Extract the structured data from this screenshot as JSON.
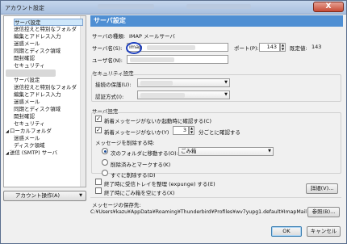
{
  "window": {
    "title": "アカウント設定",
    "close_label": "X"
  },
  "sidebar": {
    "items": [
      {
        "label": "サーバ設定",
        "indent": 1,
        "selected": true,
        "blurred": false
      },
      {
        "label": "送信控えと特別なフォルダ",
        "indent": 1,
        "selected": false,
        "blurred": false
      },
      {
        "label": "編集とアドレス入力",
        "indent": 1,
        "selected": false,
        "blurred": false
      },
      {
        "label": "迷惑メール",
        "indent": 1,
        "selected": false,
        "blurred": false
      },
      {
        "label": "同期とディスク領域",
        "indent": 1,
        "selected": false,
        "blurred": false
      },
      {
        "label": "開封確認",
        "indent": 1,
        "selected": false,
        "blurred": false
      },
      {
        "label": "セキュリティ",
        "indent": 1,
        "selected": false,
        "blurred": false
      },
      {
        "label": "xxxxxxxxxxxxxxxx",
        "indent": 0,
        "selected": false,
        "blurred": true
      },
      {
        "label": "サーバ設定",
        "indent": 1,
        "selected": false,
        "blurred": false
      },
      {
        "label": "送信控えと特別なフォルダ",
        "indent": 1,
        "selected": false,
        "blurred": false
      },
      {
        "label": "編集とアドレス入力",
        "indent": 1,
        "selected": false,
        "blurred": false
      },
      {
        "label": "迷惑メール",
        "indent": 1,
        "selected": false,
        "blurred": false
      },
      {
        "label": "同期とディスク領域",
        "indent": 1,
        "selected": false,
        "blurred": false
      },
      {
        "label": "開封確認",
        "indent": 1,
        "selected": false,
        "blurred": false
      },
      {
        "label": "セキュリティ",
        "indent": 1,
        "selected": false,
        "blurred": false
      },
      {
        "label": "ローカルフォルダ",
        "indent": 0,
        "selected": false,
        "blurred": false
      },
      {
        "label": "迷惑メール",
        "indent": 1,
        "selected": false,
        "blurred": false
      },
      {
        "label": "ディスク領域",
        "indent": 1,
        "selected": false,
        "blurred": false
      },
      {
        "label": "送信 (SMTP) サーバ",
        "indent": 0,
        "selected": false,
        "blurred": false
      }
    ],
    "account_actions_label": "アカウント操作(A)"
  },
  "main": {
    "header": "サーバ設定",
    "server_type_label": "サーバの種類:",
    "server_type_value": "IMAP メールサーバ",
    "server_name_label": "サーバ名(S):",
    "server_name_value": "imap",
    "port_label": "ポート(P):",
    "port_value": "143",
    "default_label": "既定値:",
    "default_value": "143",
    "username_label": "ユーザ名(N):",
    "security_section": "セキュリティ設定",
    "connection_security_label": "接続の保護(U):",
    "auth_method_label": "認証方式(I):",
    "server_settings_section": "サーバ設定",
    "check_startup_label": "新着メッセージがないか起動時に確認する(C)",
    "check_every_label": "新着メッセージがないか(Y)",
    "check_interval_value": "3",
    "check_every_suffix": "分ごとに確認する",
    "delete_group_label": "メッセージを削除する時:",
    "move_folder_label": "次のフォルダに移動する(O):",
    "trash_folder_value": "ごみ箱",
    "mark_deleted_label": "削除済みとマークする(K)",
    "delete_immediately_label": "すぐに削除する(D)",
    "expunge_label": "終了時に受信トレイを整理 (expunge) する(E)",
    "empty_trash_label": "終了時にごみ箱を空にする(X)",
    "advanced_button": "詳細(V)...",
    "storage_label": "メッセージの保存先:",
    "storage_path": "C:¥Users¥kazu¥AppData¥Roaming¥Thunderbird¥Profiles¥wv7yupg1.default¥ImapMail¥im",
    "browse_button": "参照(B)...",
    "ok_button": "OK",
    "cancel_button": "キャンセル"
  }
}
